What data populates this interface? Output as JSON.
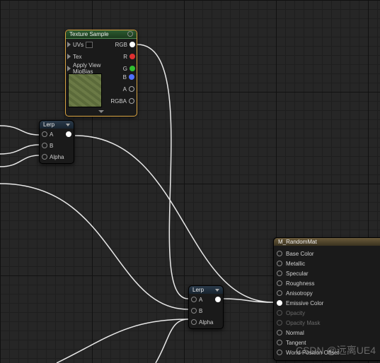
{
  "texture_sample": {
    "title": "Texture Sample",
    "inputs": {
      "uvs": "UVs",
      "tex": "Tex",
      "apply_mip": "Apply View MipBias"
    },
    "outputs": {
      "rgb": "RGB",
      "r": "R",
      "g": "G",
      "b": "B",
      "a": "A",
      "rgba": "RGBA"
    }
  },
  "lerp1": {
    "title": "Lerp",
    "inputs": {
      "a": "A",
      "b": "B",
      "alpha": "Alpha"
    }
  },
  "lerp2": {
    "title": "Lerp",
    "inputs": {
      "a": "A",
      "b": "B",
      "alpha": "Alpha"
    }
  },
  "result": {
    "title": "M_RandomMat",
    "pins": [
      {
        "label": "Base Color",
        "enabled": true,
        "connected": false
      },
      {
        "label": "Metallic",
        "enabled": true,
        "connected": false
      },
      {
        "label": "Specular",
        "enabled": true,
        "connected": false
      },
      {
        "label": "Roughness",
        "enabled": true,
        "connected": false
      },
      {
        "label": "Anisotropy",
        "enabled": true,
        "connected": false
      },
      {
        "label": "Emissive Color",
        "enabled": true,
        "connected": true
      },
      {
        "label": "Opacity",
        "enabled": false,
        "connected": false
      },
      {
        "label": "Opacity Mask",
        "enabled": false,
        "connected": false
      },
      {
        "label": "Normal",
        "enabled": true,
        "connected": false
      },
      {
        "label": "Tangent",
        "enabled": true,
        "connected": false
      },
      {
        "label": "World Position Offset",
        "enabled": true,
        "connected": false
      }
    ]
  },
  "watermark": "CSDN @远离UE4"
}
